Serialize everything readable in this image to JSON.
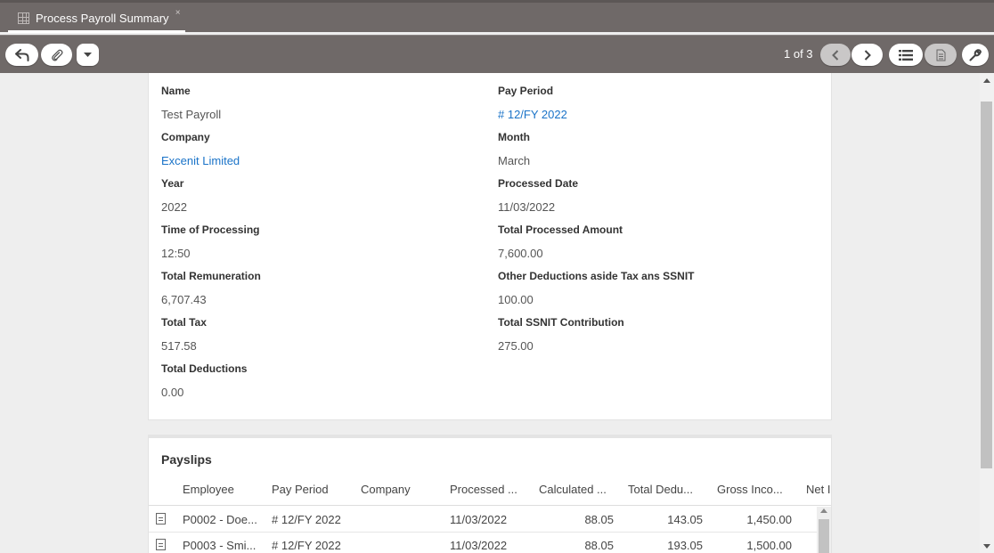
{
  "tab": {
    "title": "Process Payroll Summary",
    "close": "×"
  },
  "toolbar": {
    "pager": "1 of 3"
  },
  "form": {
    "fields_left": [
      {
        "label": "Name",
        "value": "Test Payroll",
        "link": false
      },
      {
        "label": "Company",
        "value": "Excenit Limited",
        "link": true
      },
      {
        "label": "Year",
        "value": "2022",
        "link": false
      },
      {
        "label": "Time of Processing",
        "value": "12:50",
        "link": false
      },
      {
        "label": "Total Remuneration",
        "value": "6,707.43",
        "link": false
      },
      {
        "label": "Total Tax",
        "value": "517.58",
        "link": false
      },
      {
        "label": "Total Deductions",
        "value": "0.00",
        "link": false
      }
    ],
    "fields_right": [
      {
        "label": "Pay Period",
        "value": "# 12/FY 2022",
        "link": true
      },
      {
        "label": "Month",
        "value": "March",
        "link": false
      },
      {
        "label": "Processed Date",
        "value": "11/03/2022",
        "link": false
      },
      {
        "label": "Total Processed Amount",
        "value": "7,600.00",
        "link": false
      },
      {
        "label": "Other Deductions aside Tax ans SSNIT",
        "value": "100.00",
        "link": false
      },
      {
        "label": "Total SSNIT Contribution",
        "value": "275.00",
        "link": false
      }
    ]
  },
  "payslips": {
    "title": "Payslips",
    "columns": [
      "Employee",
      "Pay Period",
      "Company",
      "Processed ...",
      "Calculated ...",
      "Total Dedu...",
      "Gross Inco...",
      "Net I"
    ],
    "rows": [
      [
        "P0002 - Doe...",
        "# 12/FY 2022",
        "",
        "11/03/2022",
        "88.05",
        "143.05",
        "1,450.00"
      ],
      [
        "P0003 - Smi...",
        "# 12/FY 2022",
        "",
        "11/03/2022",
        "88.05",
        "193.05",
        "1,500.00"
      ]
    ]
  },
  "colors": {
    "bar": "#6f6968",
    "link": "#1a73c8"
  }
}
